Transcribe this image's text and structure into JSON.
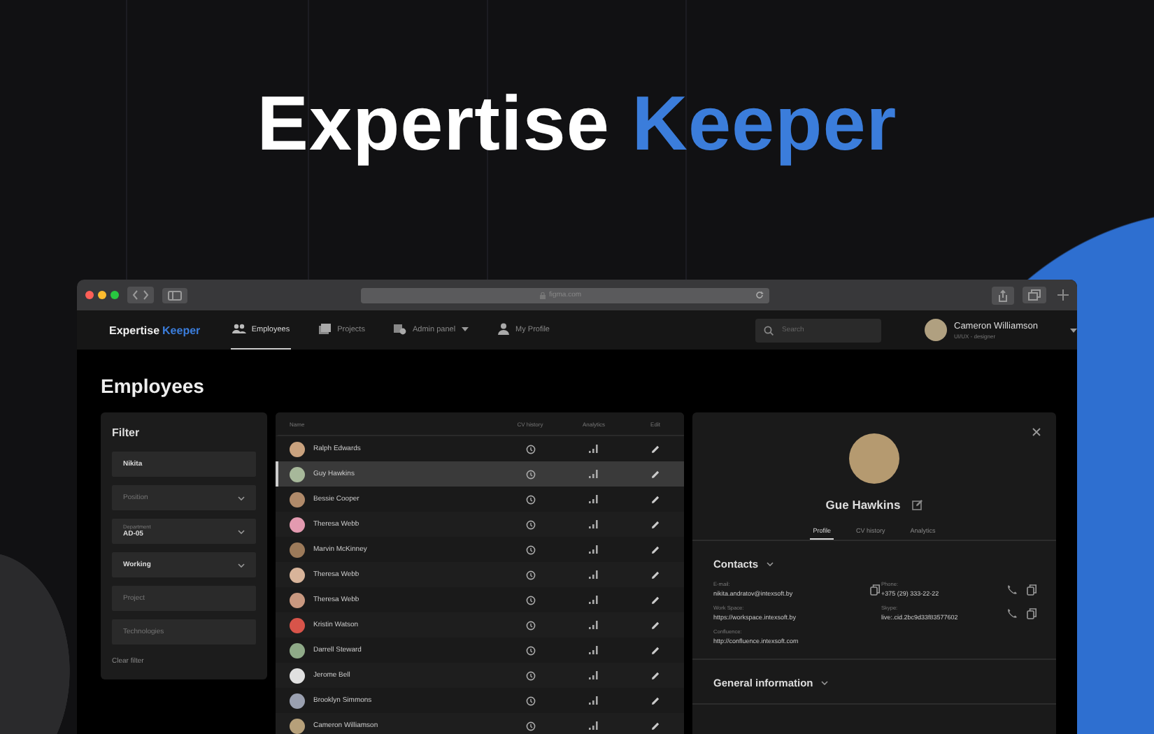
{
  "hero": {
    "word_1": "Expertise",
    "word_2": "Keeper"
  },
  "browser": {
    "url": "figma.com"
  },
  "app": {
    "logo": {
      "word_1": "Expertise",
      "word_2": "Keeper"
    },
    "nav": [
      {
        "label": "Employees",
        "selected": true,
        "dropdown": false
      },
      {
        "label": "Projects",
        "selected": false,
        "dropdown": false
      },
      {
        "label": "Admin panel",
        "selected": false,
        "dropdown": true
      },
      {
        "label": "My Profile",
        "selected": false,
        "dropdown": false
      }
    ],
    "search": {
      "placeholder": "Search"
    },
    "user": {
      "name": "Cameron Williamson",
      "role": "UI/UX - designer"
    }
  },
  "page_title": "Employees",
  "filter": {
    "title": "Filter",
    "fields": [
      {
        "kind": "text",
        "value": "Nikita"
      },
      {
        "kind": "select",
        "placeholder": "Position"
      },
      {
        "kind": "select",
        "label": "Department",
        "value": "AD-05"
      },
      {
        "kind": "select",
        "value": "Working"
      },
      {
        "kind": "text",
        "placeholder": "Project"
      },
      {
        "kind": "text",
        "placeholder": "Technologies"
      }
    ],
    "clear": "Clear filter"
  },
  "table": {
    "columns": [
      "Name",
      "CV history",
      "Analytics",
      "Edit"
    ],
    "rows": [
      {
        "name": "Ralph Edwards",
        "selected": false
      },
      {
        "name": "Guy Hawkins",
        "selected": true
      },
      {
        "name": "Bessie Cooper",
        "selected": false
      },
      {
        "name": "Theresa Webb",
        "selected": false
      },
      {
        "name": "Marvin McKinney",
        "selected": false
      },
      {
        "name": "Theresa Webb",
        "selected": false
      },
      {
        "name": "Theresa Webb",
        "selected": false
      },
      {
        "name": "Kristin Watson",
        "selected": false
      },
      {
        "name": "Darrell Steward",
        "selected": false
      },
      {
        "name": "Jerome Bell",
        "selected": false
      },
      {
        "name": "Brooklyn Simmons",
        "selected": false
      },
      {
        "name": "Cameron Williamson",
        "selected": false
      }
    ]
  },
  "detail": {
    "name": "Gue Hawkins",
    "tabs": [
      {
        "label": "Profile",
        "selected": true
      },
      {
        "label": "CV history",
        "selected": false
      },
      {
        "label": "Analytics",
        "selected": false
      }
    ],
    "sections": [
      {
        "title": "Contacts",
        "items": [
          {
            "kind": "copyable",
            "label": "E-mail:",
            "value": "nikita.andratov@intexsoft.by"
          },
          {
            "kind": "callable",
            "label": "Phone:",
            "value": "+375 (29) 333-22-22"
          },
          {
            "kind": "plain",
            "label": "Work Space:",
            "value": "https://workspace.intexsoft.by"
          },
          {
            "kind": "callable",
            "label": "Skype:",
            "value": "live:.cid.2bc9d33f83577602"
          },
          {
            "kind": "plain",
            "label": "Confluence:",
            "value": "http://confluence.intexsoft.com"
          }
        ]
      },
      {
        "title": "General information"
      }
    ]
  }
}
